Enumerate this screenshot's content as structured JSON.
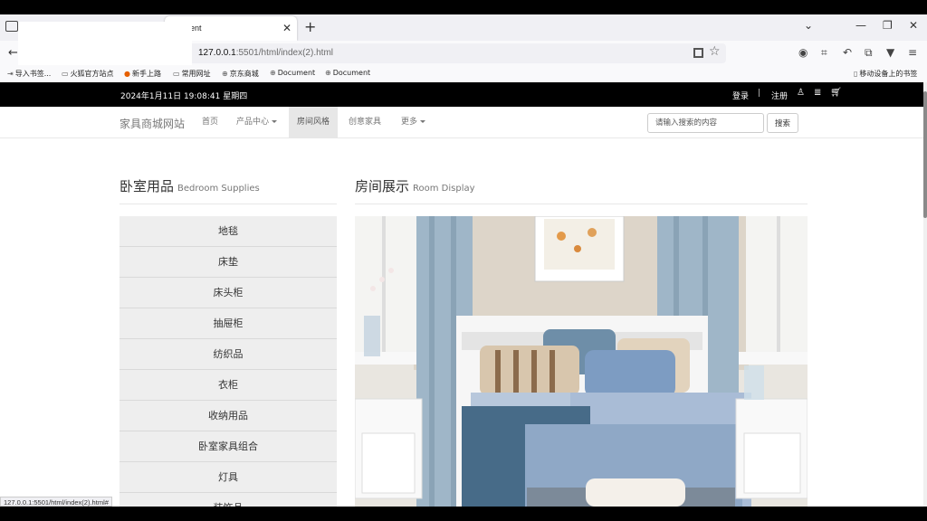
{
  "browser": {
    "tab_title": "ent",
    "url_host": "127.0.0.1",
    "url_path": ":5501/html/index(2).html",
    "bookmarks": [
      "导入书签...",
      "火狐官方站点",
      "新手上路",
      "常用网址",
      "京东商城",
      "Document",
      "Document"
    ],
    "mobile_bookmarks": "移动设备上的书签",
    "status_url": "127.0.0.1:5501/html/index(2).html#"
  },
  "topbar": {
    "datetime": "2024年1月11日 19:08:41 星期四",
    "login": "登录",
    "separator": "|",
    "register": "注册"
  },
  "nav": {
    "brand": "家具商城网站",
    "items": [
      "首页",
      "产品中心",
      "房间风格",
      "创意家具",
      "更多"
    ],
    "search_placeholder": "请输入搜索的内容",
    "search_button": "搜索"
  },
  "sidebar": {
    "title": "卧室用品",
    "title_en": "Bedroom Supplies",
    "items": [
      "地毯",
      "床垫",
      "床头柜",
      "抽屉柜",
      "纺织品",
      "衣柜",
      "收纳用品",
      "卧室家具组合",
      "灯具",
      "装饰品"
    ]
  },
  "display": {
    "title": "房间展示",
    "title_en": "Room Display"
  }
}
